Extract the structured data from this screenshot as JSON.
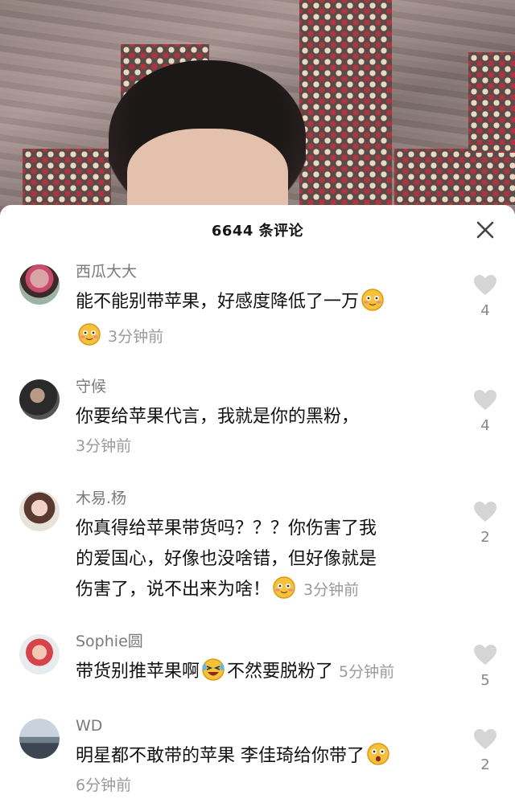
{
  "header": {
    "count_title": "6644 条评论"
  },
  "comments": [
    {
      "user": "西瓜大大",
      "text": "能不能别带苹果，好感度降低了一万",
      "time": "3分钟前",
      "likes": "4"
    },
    {
      "user": "守候",
      "text": "你要给苹果代言，我就是你的黑粉，",
      "time": "3分钟前",
      "likes": "4"
    },
    {
      "user": "木易.杨",
      "text_l1": "你真得给苹果带货吗？？？你伤害了我",
      "text_l2": "的爱国心，好像也没啥错，但好像就是",
      "text_l3": "伤害了，说不出来为啥！",
      "time": "3分钟前",
      "likes": "2"
    },
    {
      "user": "Sophie圆",
      "text_a": "带货别推苹果啊",
      "text_b": "不然要脱粉了",
      "time": "5分钟前",
      "likes": "5"
    },
    {
      "user": "WD",
      "text": "明星都不敢带的苹果 李佳琦给你带了",
      "time": "6分钟前",
      "likes": "2"
    }
  ],
  "icons": {
    "close": "close-icon",
    "like": "heart-icon",
    "emoji_smile": "blushing-smile-emoji",
    "emoji_laugh": "rolling-laughing-emoji",
    "emoji_surprised": "surprised-emoji"
  },
  "colors": {
    "like_heart": "#d5d5d5",
    "meta_text": "#9a9a9a"
  }
}
